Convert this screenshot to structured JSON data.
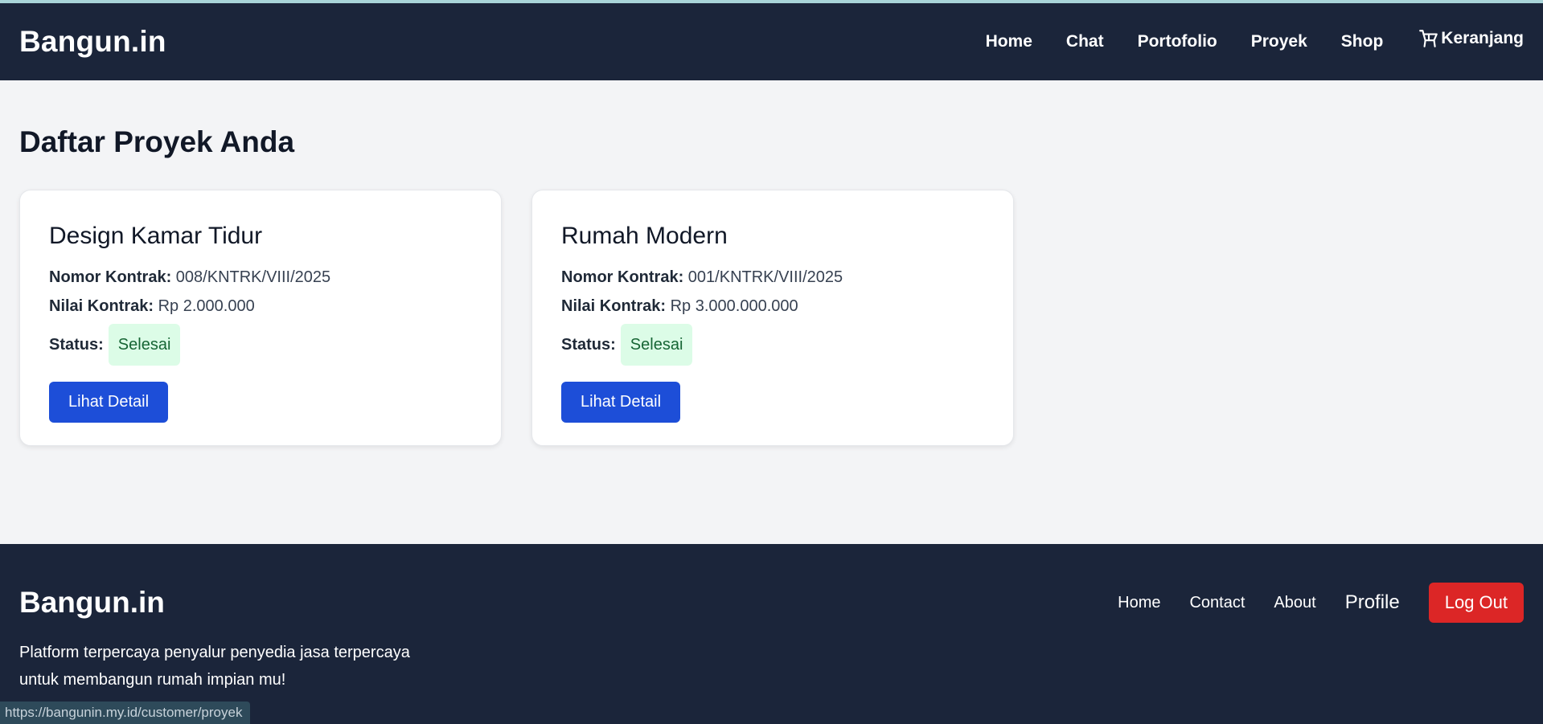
{
  "header": {
    "brand": "Bangun.in",
    "nav": [
      "Home",
      "Chat",
      "Portofolio",
      "Proyek",
      "Shop"
    ],
    "cart_label": "Keranjang",
    "cart_icon": "cart-icon"
  },
  "main": {
    "title": "Daftar Proyek Anda",
    "projects": [
      {
        "title": "Design Kamar Tidur",
        "contract_no_label": "Nomor Kontrak:",
        "contract_no": "008/KNTRK/VIII/2025",
        "contract_value_label": "Nilai Kontrak:",
        "contract_value": "Rp 2.000.000",
        "status_label": "Status:",
        "status": "Selesai",
        "button": "Lihat Detail"
      },
      {
        "title": "Rumah Modern",
        "contract_no_label": "Nomor Kontrak:",
        "contract_no": "001/KNTRK/VIII/2025",
        "contract_value_label": "Nilai Kontrak:",
        "contract_value": "Rp 3.000.000.000",
        "status_label": "Status:",
        "status": "Selesai",
        "button": "Lihat Detail"
      }
    ]
  },
  "footer": {
    "brand": "Bangun.in",
    "tagline": "Platform terpercaya penyalur penyedia jasa terpercaya untuk membangun rumah impian mu!",
    "links": [
      "Home",
      "Contact",
      "About",
      "Profile"
    ],
    "logout": "Log Out"
  },
  "status_url": "https://bangunin.my.id/customer/proyek",
  "colors": {
    "nav_bg": "#1b253a",
    "primary": "#1d4ed8",
    "danger": "#dc2626",
    "success_bg": "#dcfce7",
    "success_text": "#166534"
  }
}
